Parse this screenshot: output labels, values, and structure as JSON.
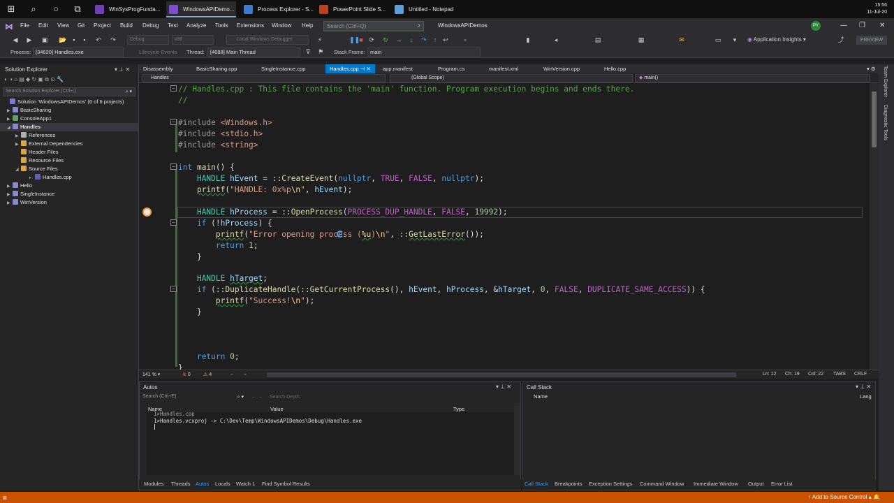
{
  "taskbar": {
    "apps": [
      {
        "label": "WinSysProgFunda...",
        "color": "#6f3fb5"
      },
      {
        "label": "WindowsAPIDemo...",
        "color": "#7b4fd0",
        "active": true
      },
      {
        "label": "Process Explorer - S...",
        "color": "#3b7bd4"
      },
      {
        "label": "PowerPoint Slide S...",
        "color": "#c43e1c"
      },
      {
        "label": "Untitled - Notepad",
        "color": "#5aa0e0"
      }
    ],
    "time": "15:56",
    "date": "11-Jul-20"
  },
  "menu": {
    "items": [
      "File",
      "Edit",
      "View",
      "Git",
      "Project",
      "Build",
      "Debug",
      "Test",
      "Analyze",
      "Tools",
      "Extensions",
      "Window",
      "Help"
    ],
    "search_placeholder": "Search (Ctrl+Q)",
    "solution_name": "WindowsAPIDemos",
    "avatar": "PY"
  },
  "toolbar": {
    "config": "Debug",
    "platform": "x86",
    "debugger": "Local Windows Debugger",
    "app_insights": "Application Insights",
    "preview": "PREVIEW"
  },
  "debug_location": {
    "process_label": "Process:",
    "process_value": "[34620] Handles.exe",
    "lifecycle": "Lifecycle Events",
    "thread_label": "Thread:",
    "thread_value": "[4088] Main Thread",
    "frame_label": "Stack Frame:",
    "frame_value": "main"
  },
  "solution_explorer": {
    "title": "Solution Explorer",
    "search_placeholder": "Search Solution Explorer (Ctrl+;)",
    "items": [
      "Solution 'WindowsAPIDemos' (6 of 6 projects)",
      "BasicSharing",
      "ConsoleApp1",
      "Handles",
      "References",
      "External Dependencies",
      "Header Files",
      "Resource Files",
      "Source Files",
      "Handles.cpp",
      "Hello",
      "SingleInstance",
      "WinVersion"
    ]
  },
  "tabs": [
    "Disassembly",
    "BasicSharing.cpp",
    "SingleInstance.cpp",
    "Handles.cpp",
    "app.manifest",
    "Program.cs",
    "manifest.xml",
    "WinVersion.cpp",
    "Hello.cpp"
  ],
  "navbar": {
    "project": "Handles",
    "scope": "(Global Scope)",
    "member": "main()"
  },
  "code": {
    "comment1": "// Handles.cpp : This file contains the 'main' function. Program execution begins and ends there.",
    "comment2": "//",
    "inc1": "<Windows.h>",
    "inc2": "<stdio.h>",
    "inc3": "<string>"
  },
  "editor_status": {
    "zoom": "141 %",
    "errors": "0",
    "warnings": "4",
    "line": "Ln: 12",
    "col": "Ch: 19",
    "colnum": "Col: 22",
    "tabs": "TABS",
    "eol": "CRLF"
  },
  "autos": {
    "title": "Autos",
    "search_placeholder": "Search (Ctrl+E)",
    "search_depth": "Search Depth:",
    "columns": [
      "Name",
      "Value",
      "Type"
    ],
    "output_lines": [
      "1>Handles.cpp",
      "1>Handles.vcxproj -> C:\\Dev\\Temp\\WindowsAPIDemos\\Debug\\Handles.exe"
    ]
  },
  "callstack": {
    "title": "Call Stack",
    "columns": [
      "Name",
      "Lang"
    ]
  },
  "bottom_tabs_left": [
    "Modules",
    "Threads",
    "Autos",
    "Locals",
    "Watch 1",
    "Find Symbol Results"
  ],
  "bottom_tabs_right": [
    "Call Stack",
    "Breakpoints",
    "Exception Settings",
    "Command Window",
    "Immediate Window",
    "Output",
    "Error List"
  ],
  "side_strip": [
    "Team Explorer",
    "Diagnostic Tools"
  ],
  "statusbar": {
    "add_source": "Add to Source Control"
  }
}
